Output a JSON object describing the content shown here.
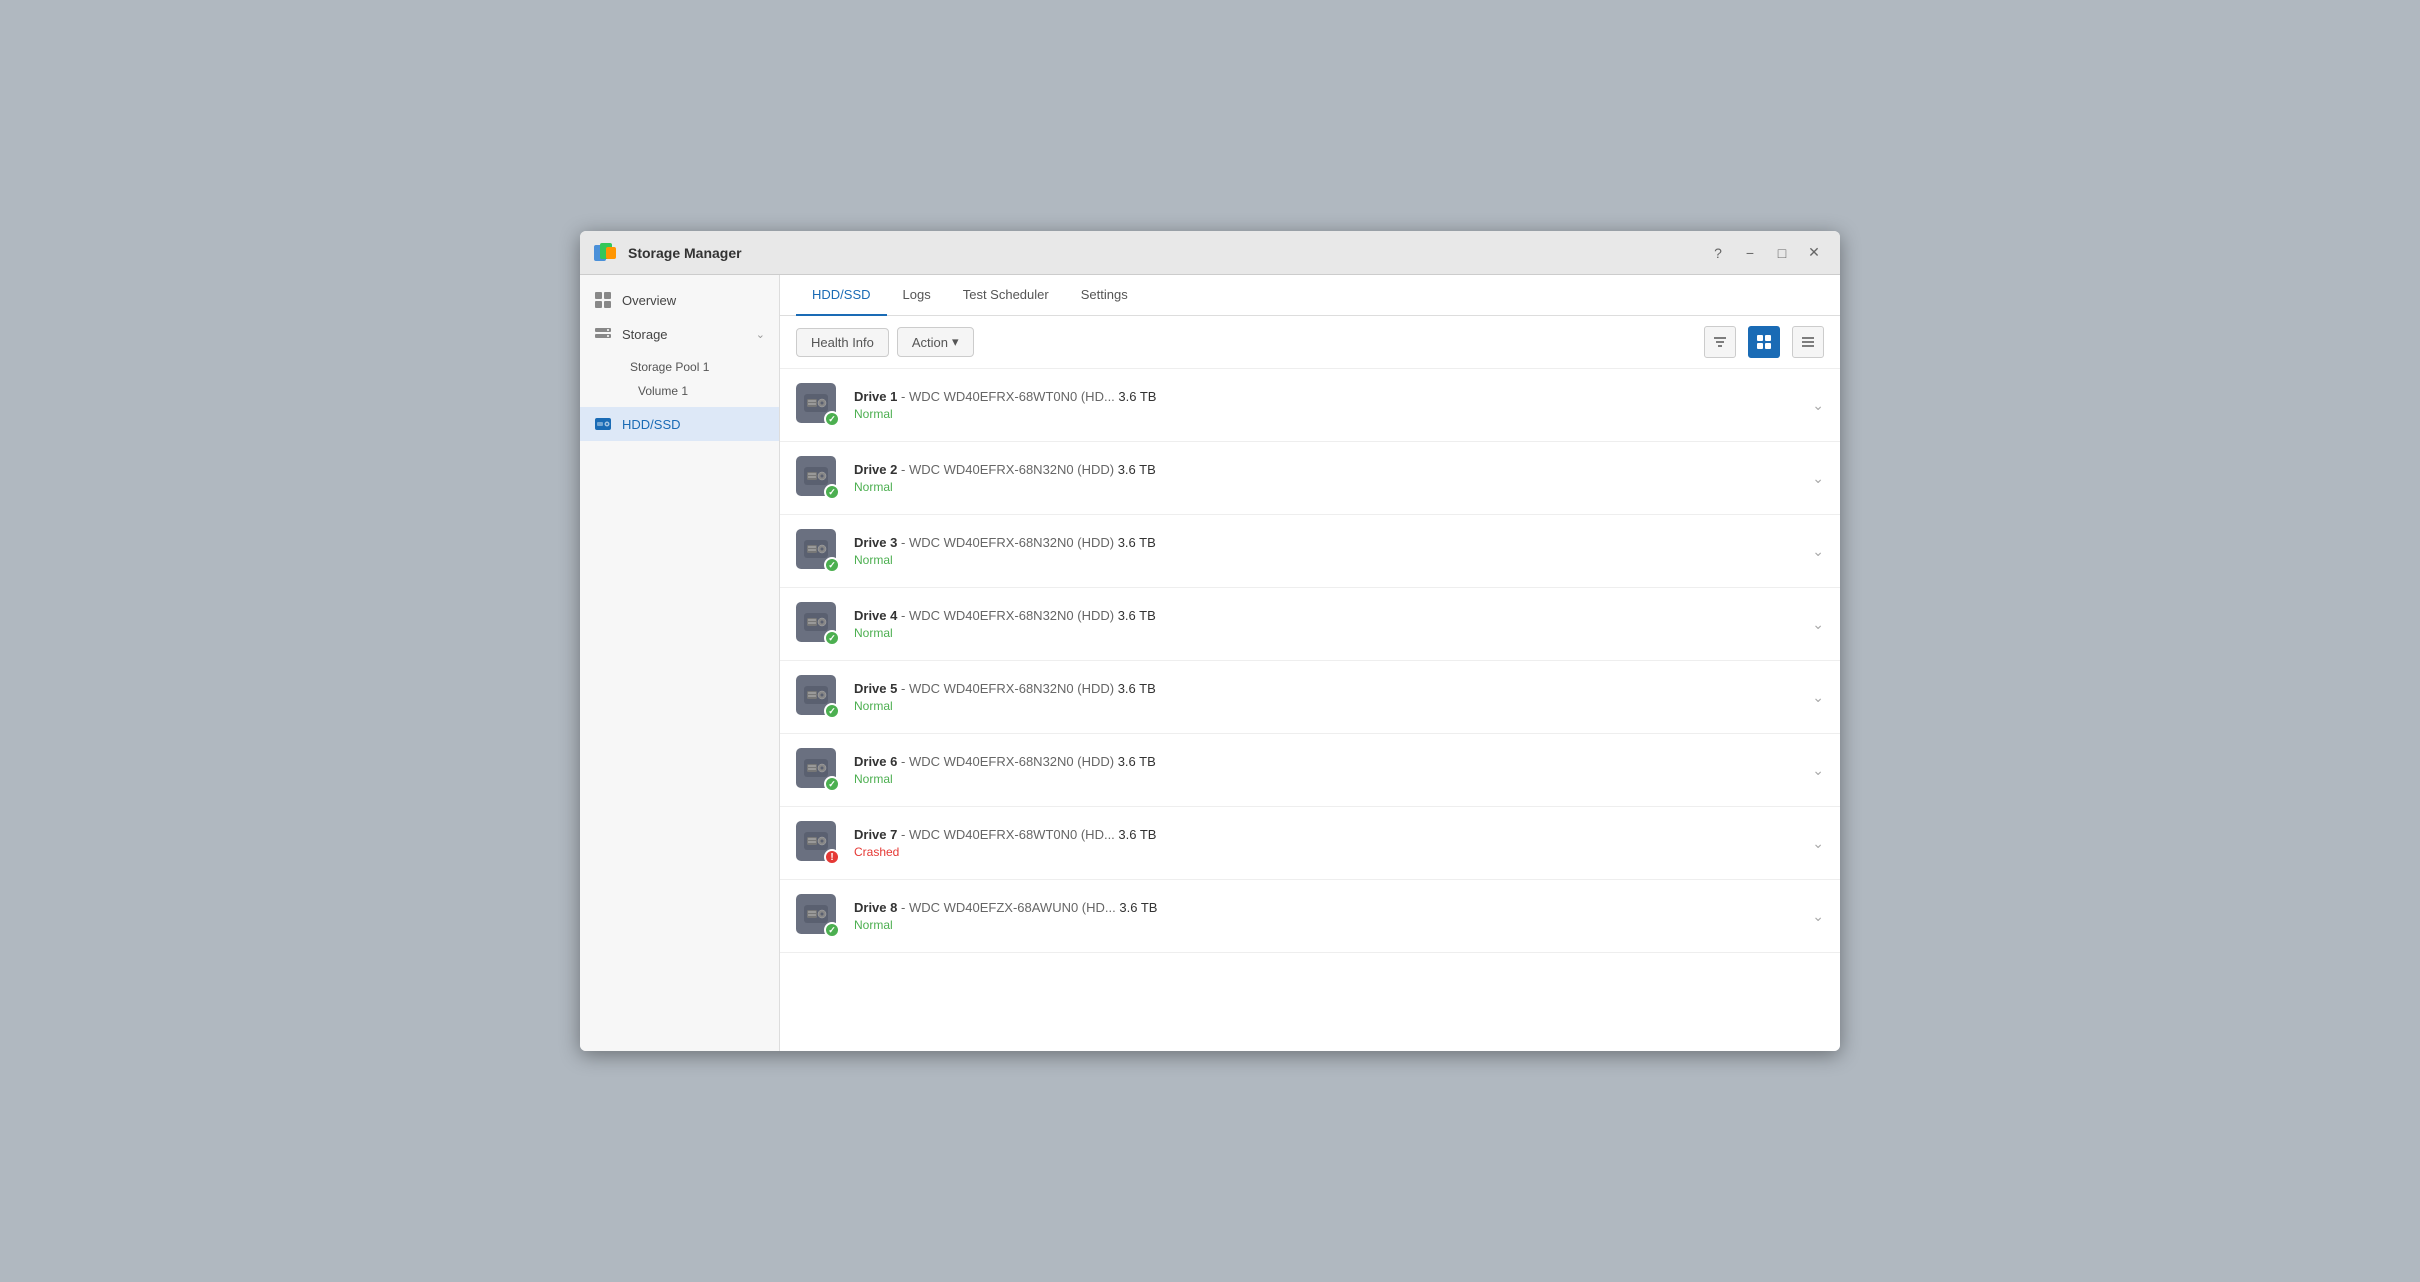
{
  "window": {
    "title": "Storage Manager",
    "controls": [
      "help",
      "minimize",
      "maximize",
      "close"
    ]
  },
  "sidebar": {
    "overview_label": "Overview",
    "storage_label": "Storage",
    "storage_pool_label": "Storage Pool 1",
    "volume_label": "Volume 1",
    "hdd_ssd_label": "HDD/SSD"
  },
  "tabs": [
    {
      "id": "hdd-ssd",
      "label": "HDD/SSD",
      "active": true
    },
    {
      "id": "logs",
      "label": "Logs",
      "active": false
    },
    {
      "id": "test-scheduler",
      "label": "Test Scheduler",
      "active": false
    },
    {
      "id": "settings",
      "label": "Settings",
      "active": false
    }
  ],
  "toolbar": {
    "health_info_label": "Health Info",
    "action_label": "Action",
    "action_arrow": "▾"
  },
  "drives": [
    {
      "id": 1,
      "name": "Drive 1",
      "model": "WDC WD40EFRX-68WT0N0 (HD...",
      "type": "HDD",
      "size": "3.6 TB",
      "health": "Normal",
      "status": "ok"
    },
    {
      "id": 2,
      "name": "Drive 2",
      "model": "WDC WD40EFRX-68N32N0 (HDD)",
      "type": "HDD",
      "size": "3.6 TB",
      "health": "Normal",
      "status": "ok"
    },
    {
      "id": 3,
      "name": "Drive 3",
      "model": "WDC WD40EFRX-68N32N0 (HDD)",
      "type": "HDD",
      "size": "3.6 TB",
      "health": "Normal",
      "status": "ok"
    },
    {
      "id": 4,
      "name": "Drive 4",
      "model": "WDC WD40EFRX-68N32N0 (HDD)",
      "type": "HDD",
      "size": "3.6 TB",
      "health": "Normal",
      "status": "ok"
    },
    {
      "id": 5,
      "name": "Drive 5",
      "model": "WDC WD40EFRX-68N32N0 (HDD)",
      "type": "HDD",
      "size": "3.6 TB",
      "health": "Normal",
      "status": "ok"
    },
    {
      "id": 6,
      "name": "Drive 6",
      "model": "WDC WD40EFRX-68N32N0 (HDD)",
      "type": "HDD",
      "size": "3.6 TB",
      "health": "Normal",
      "status": "ok"
    },
    {
      "id": 7,
      "name": "Drive 7",
      "model": "WDC WD40EFRX-68WT0N0 (HD...",
      "type": "HDD",
      "size": "3.6 TB",
      "health": "Crashed",
      "status": "error"
    },
    {
      "id": 8,
      "name": "Drive 8",
      "model": "WDC WD40EFZX-68AWUN0 (HD...",
      "type": "HDD",
      "size": "3.6 TB",
      "health": "Normal",
      "status": "ok"
    }
  ],
  "colors": {
    "accent": "#1a6bb5",
    "normal": "#4caf50",
    "crashed": "#e53935"
  }
}
